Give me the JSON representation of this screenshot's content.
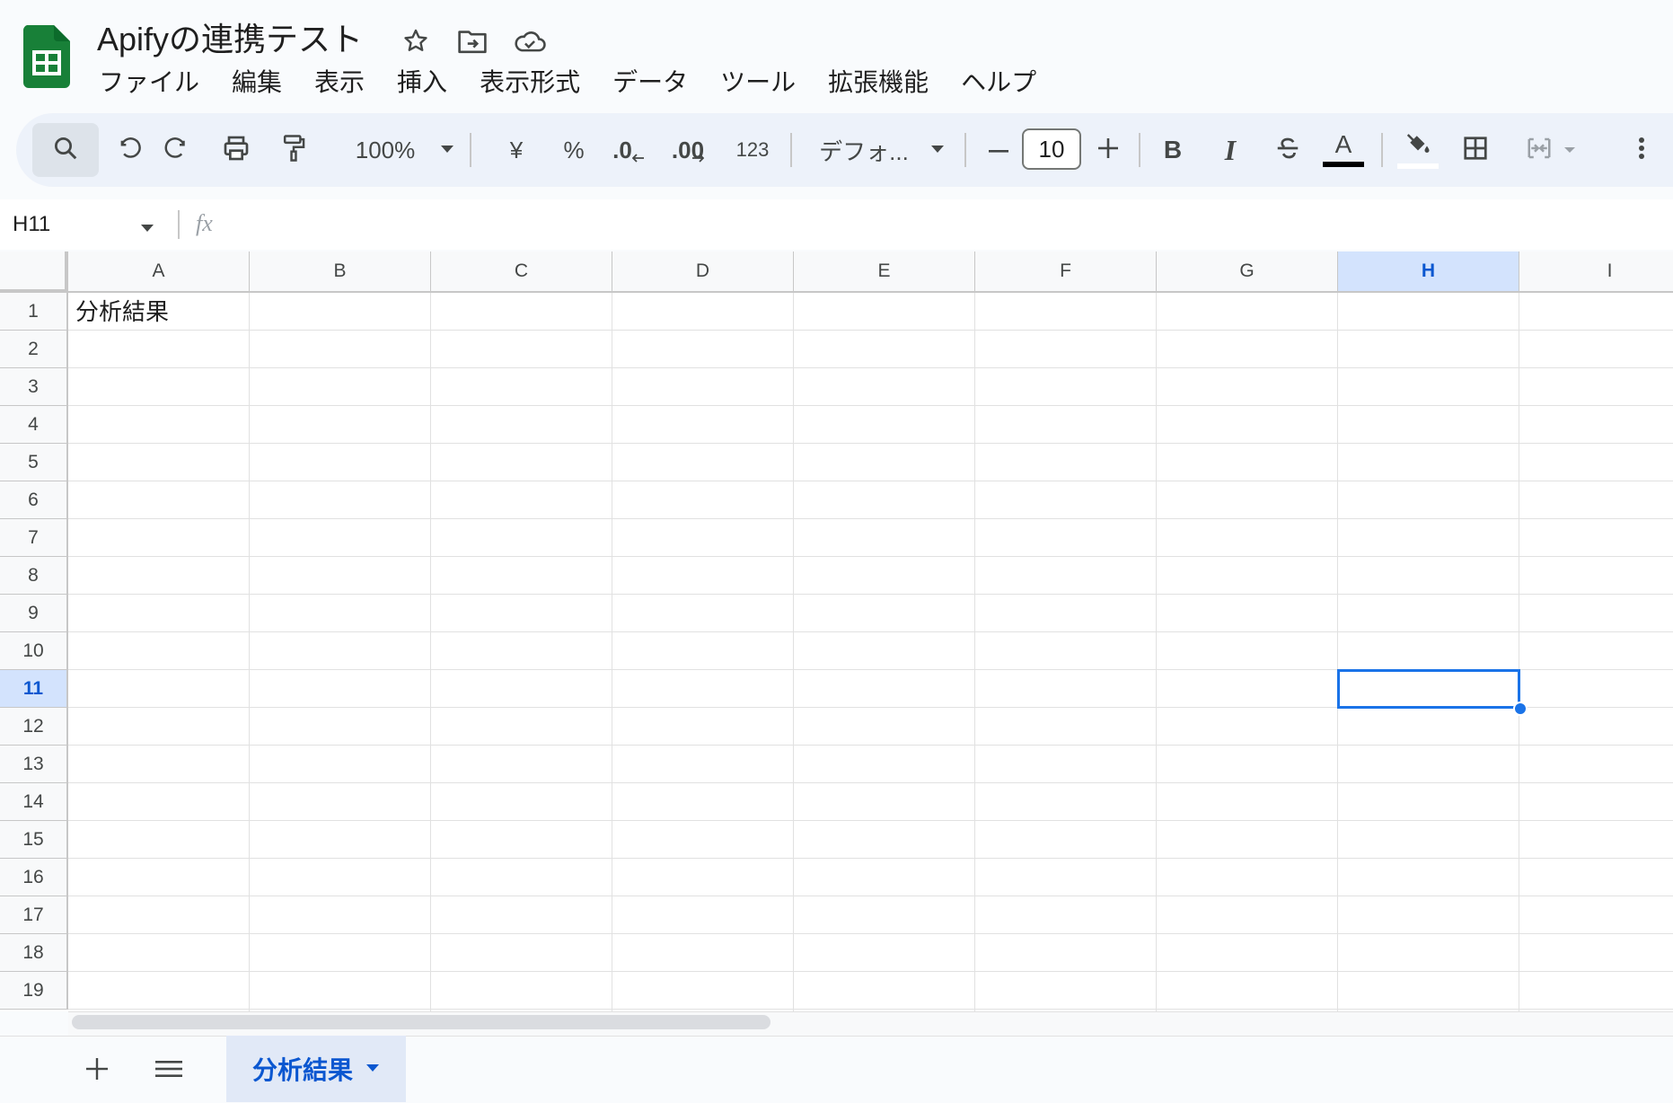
{
  "document": {
    "title": "Apifyの連携テスト"
  },
  "menu": {
    "items": [
      {
        "label": "ファイル"
      },
      {
        "label": "編集"
      },
      {
        "label": "表示"
      },
      {
        "label": "挿入"
      },
      {
        "label": "表示形式"
      },
      {
        "label": "データ"
      },
      {
        "label": "ツール"
      },
      {
        "label": "拡張機能"
      },
      {
        "label": "ヘルプ"
      }
    ]
  },
  "toolbar": {
    "zoom": "100%",
    "currency_label": "¥",
    "percent_label": "%",
    "decrease_decimal_label": ".0",
    "increase_decimal_label": ".00",
    "number_format_label": "123",
    "font_family": "デフォ...",
    "font_size": "10",
    "bold_label": "B",
    "italic_label": "I",
    "text_color_label": "A",
    "icons": [
      "search-icon",
      "undo-icon",
      "redo-icon",
      "print-icon",
      "paint-format-icon",
      "strikethrough-icon",
      "fill-color-icon",
      "borders-icon",
      "merge-cells-icon",
      "more-vert-icon"
    ]
  },
  "formula_bar": {
    "name_box": "H11",
    "fx_label": "fx",
    "value": ""
  },
  "grid": {
    "columns": [
      "A",
      "B",
      "C",
      "D",
      "E",
      "F",
      "G",
      "H",
      "I"
    ],
    "rows": [
      "1",
      "2",
      "3",
      "4",
      "5",
      "6",
      "7",
      "8",
      "9",
      "10",
      "11",
      "12",
      "13",
      "14",
      "15",
      "16",
      "17",
      "18",
      "19"
    ],
    "selected_cell": "H11",
    "selected_column": "H",
    "selected_row": "11",
    "cells": {
      "A1": "分析結果"
    }
  },
  "sheets": {
    "tabs": [
      {
        "label": "分析結果",
        "active": true
      }
    ]
  },
  "colors": {
    "accent": "#1a73e8",
    "sheets_green": "#188038",
    "selected_header": "#d3e3fd",
    "toolbar_bg": "#edf2fa"
  }
}
